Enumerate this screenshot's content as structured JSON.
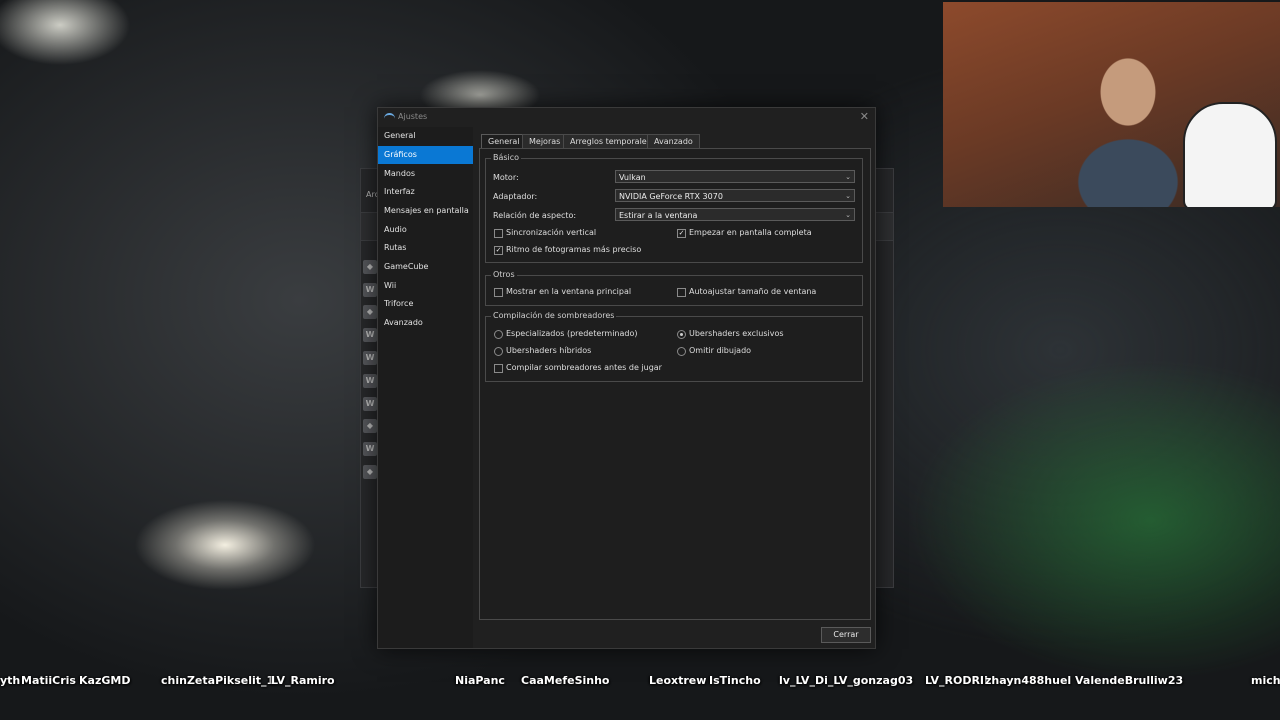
{
  "window": {
    "title": "Ajustes",
    "close_glyph": "✕"
  },
  "sidebar": {
    "items": [
      {
        "label": "General"
      },
      {
        "label": "Gráficos"
      },
      {
        "label": "Mandos"
      },
      {
        "label": "Interfaz"
      },
      {
        "label": "Mensajes en pantalla"
      },
      {
        "label": "Audio"
      },
      {
        "label": "Rutas"
      },
      {
        "label": "GameCube"
      },
      {
        "label": "Wii"
      },
      {
        "label": "Triforce"
      },
      {
        "label": "Avanzado"
      }
    ],
    "selected": "Gráficos"
  },
  "tabs": [
    {
      "label": "General"
    },
    {
      "label": "Mejoras"
    },
    {
      "label": "Arreglos temporales"
    },
    {
      "label": "Avanzado"
    }
  ],
  "active_tab": "General",
  "basico": {
    "title": "Básico",
    "motor_label": "Motor:",
    "motor_value": "Vulkan",
    "adaptador_label": "Adaptador:",
    "adaptador_value": "NVIDIA GeForce RTX 3070",
    "aspecto_label": "Relación de aspecto:",
    "aspecto_value": "Estirar a la ventana",
    "vsync": {
      "label": "Sincronización vertical",
      "checked": false
    },
    "fullscreen": {
      "label": "Empezar en pantalla completa",
      "checked": true
    },
    "precise_fps": {
      "label": "Ritmo de fotogramas más preciso",
      "checked": true
    }
  },
  "otros": {
    "title": "Otros",
    "show_main": {
      "label": "Mostrar en la ventana principal",
      "checked": false
    },
    "autoadjust": {
      "label": "Autoajustar tamaño de ventana",
      "checked": false
    }
  },
  "shaders": {
    "title": "Compilación de sombreadores",
    "specialized": {
      "label": "Especializados (predeterminado)",
      "selected": false
    },
    "ubershaders_exclusive": {
      "label": "Ubershaders exclusivos",
      "selected": true
    },
    "ubershaders_hybrid": {
      "label": "Ubershaders híbridos",
      "selected": false
    },
    "skip_draw": {
      "label": "Omitir dibujado",
      "selected": false
    },
    "compile_before": {
      "label": "Compilar sombreadores antes de jugar",
      "checked": false
    }
  },
  "buttons": {
    "close": "Cerrar"
  },
  "background_window": {
    "title_fragment": "Arc"
  },
  "chat_names": [
    "yth",
    "MatiiCris",
    "KazGMD",
    "chinZetaPikselit_1",
    "LV_Ramiro",
    "NiaPanc",
    "CaaMefeSinho",
    "Leoxtrew",
    "IsTincho",
    "lv_LV_Di_LV_gonzag03",
    "LV_RODRII",
    "zhayn488huel",
    "ValendeBrulliw23",
    "mich"
  ],
  "colors": {
    "selection": "#0a78d4",
    "dialog_bg": "#202020",
    "sidebar_bg": "#1c1c1c"
  }
}
